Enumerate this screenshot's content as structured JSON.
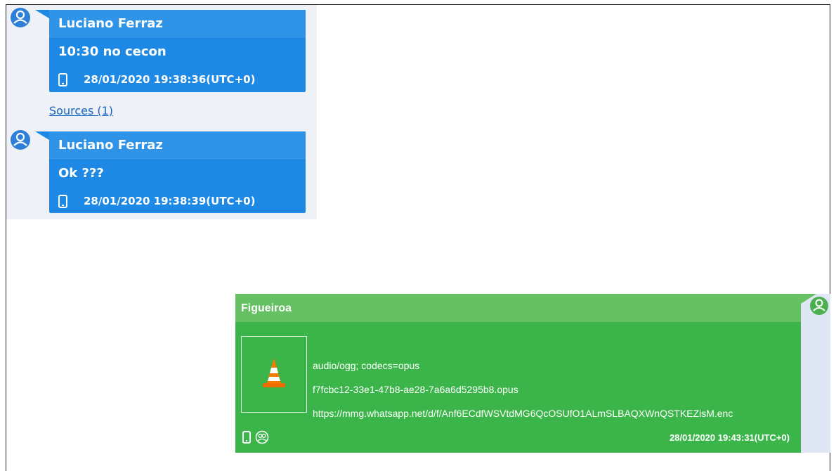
{
  "messages": [
    {
      "sender": "Luciano Ferraz",
      "text": "10:30 no cecon",
      "timestamp": "28/01/2020 19:38:36(UTC+0)",
      "icon": "phone-icon"
    },
    {
      "sender": "Luciano Ferraz",
      "text": "Ok ???",
      "timestamp": "28/01/2020 19:38:39(UTC+0)",
      "icon": "phone-icon"
    }
  ],
  "sources_link": "Sources (1)",
  "attachment_message": {
    "sender": "Figueiroa",
    "mime": "audio/ogg; codecs=opus",
    "filename": "f7fcbc12-33e1-47b8-ae28-7a6a6d5295b8.opus",
    "url": "https://mmg.whatsapp.net/d/f/Anf6ECdfWSVtdMG6QcOSUfO1ALmSLBAQXWnQSTKEZisM.enc",
    "timestamp": "28/01/2020 19:43:31(UTC+0)",
    "thumbnail_icon": "vlc-cone-icon"
  },
  "colors": {
    "incoming_bubble": "#1e88e5",
    "outgoing_bubble": "#3bb54a",
    "avatar_blue": "#2d7fd8",
    "avatar_green": "#4caf50"
  }
}
